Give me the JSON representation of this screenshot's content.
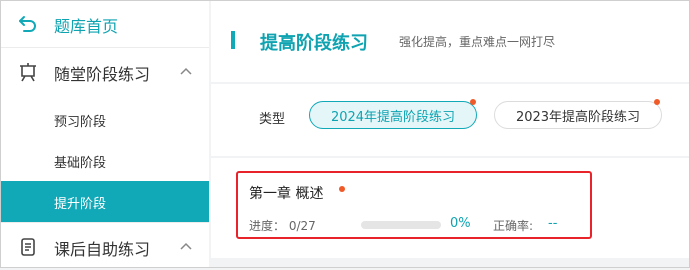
{
  "colors": {
    "accent": "#11a9b8",
    "alert_dot": "#f05a28",
    "highlight_box": "#e8242a"
  },
  "sidebar": {
    "home": {
      "label": "题库首页",
      "icon": "back-arrow-icon"
    },
    "groups": [
      {
        "label": "随堂阶段练习",
        "icon": "easel-icon",
        "expanded": true,
        "items": [
          {
            "label": "预习阶段",
            "active": false
          },
          {
            "label": "基础阶段",
            "active": false
          },
          {
            "label": "提升阶段",
            "active": true
          }
        ]
      },
      {
        "label": "课后自助练习",
        "icon": "scroll-icon",
        "expanded": true
      }
    ]
  },
  "header": {
    "title": "提高阶段练习",
    "subtitle": "强化提高，重点难点一网打尽"
  },
  "filter": {
    "label": "类型",
    "options": [
      {
        "label": "2024年提高阶段练习",
        "selected": true,
        "has_dot": true
      },
      {
        "label": "2023年提高阶段练习",
        "selected": false,
        "has_dot": true
      }
    ]
  },
  "chapter": {
    "title": "第一章 概述",
    "progress_label": "进度：",
    "progress_value": "0/27",
    "progress_fraction": 0,
    "percent": "0%",
    "accuracy_label": "正确率:",
    "accuracy_value": "--"
  }
}
